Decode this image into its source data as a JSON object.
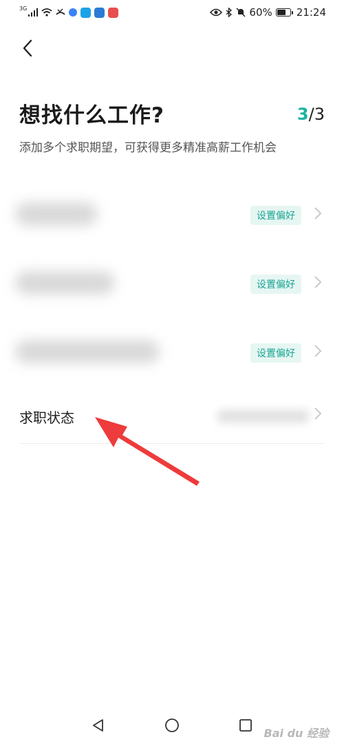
{
  "status_bar": {
    "network": "3G",
    "battery": "60%",
    "time": "21:24",
    "colors": {
      "app1": "#3b82f6",
      "app2": "#1aa3e8",
      "app3": "#2a7bd6",
      "app4": "#e94e4e"
    }
  },
  "header": {
    "back_icon": "chevron-left-icon",
    "title": "想找什么工作?",
    "progress_current": "3",
    "progress_separator": "/",
    "progress_total": "3",
    "subtitle": "添加多个求职期望，可获得更多精准高薪工作机会"
  },
  "expectations": [
    {
      "action_label": "设置偏好"
    },
    {
      "action_label": "设置偏好"
    },
    {
      "action_label": "设置偏好"
    }
  ],
  "job_status": {
    "label": "求职状态"
  },
  "nav": {
    "back": "triangle-back-icon",
    "home": "circle-home-icon",
    "recent": "square-recent-icon"
  },
  "watermark": "Bai du 经验",
  "colors": {
    "accent": "#19b3a0",
    "badge_bg": "#e6f6f3",
    "badge_text": "#1aa592",
    "arrow": "#ee3b3b"
  }
}
